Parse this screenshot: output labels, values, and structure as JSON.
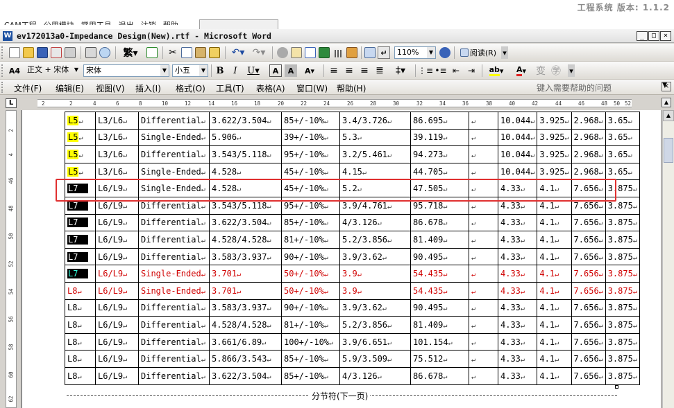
{
  "host": {
    "title": "工程系统 版本: 1.1.2",
    "menu": [
      "CAM工程",
      "公用模块",
      "常用工具",
      "退出",
      "注销",
      "帮助"
    ]
  },
  "window": {
    "title": "ev172013a0-Impedance Design(New).rtf - Microsoft Word",
    "min_label": "_",
    "max_label": "□",
    "close_label": "×"
  },
  "toolbar": {
    "zoom": "110%",
    "read_label": "阅读(R)",
    "style": "正文 + 宋体",
    "font": "宋体",
    "size": "小五",
    "bold": "B",
    "italic": "I",
    "underline": "U"
  },
  "menubar": {
    "items": [
      "文件(F)",
      "编辑(E)",
      "视图(V)",
      "插入(I)",
      "格式(O)",
      "工具(T)",
      "表格(A)",
      "窗口(W)",
      "帮助(H)"
    ],
    "help_placeholder": "键入需要帮助的问题"
  },
  "ruler": {
    "corner": "L",
    "h_ticks": [
      "2",
      "2",
      "4",
      "6",
      "8",
      "10",
      "12",
      "14",
      "16",
      "18",
      "20",
      "22",
      "24",
      "26",
      "28",
      "30",
      "32",
      "34",
      "36",
      "38",
      "40",
      "42",
      "44",
      "46",
      "48",
      "50",
      "52"
    ],
    "v_ticks": [
      "2",
      "4",
      "46",
      "48",
      "50",
      "52",
      "54",
      "56",
      "58",
      "60",
      "62",
      "64"
    ]
  },
  "table": {
    "rows": [
      {
        "layer": "L5",
        "layer_style": "yellow",
        "ref": "L3/L6",
        "type": "Differential",
        "width": "3.622/3.504",
        "imp": "85+/-10%",
        "calc": "3.4/3.726",
        "val": "86.695",
        "e": "",
        "c1": "10.044",
        "c2": "3.925",
        "c3": "2.968",
        "c4": "3.65",
        "red": false
      },
      {
        "layer": "L5",
        "layer_style": "yellow",
        "ref": "L3/L6",
        "type": "Single-Ended",
        "width": "5.906",
        "imp": "39+/-10%",
        "calc": "5.3",
        "val": "39.119",
        "e": "",
        "c1": "10.044",
        "c2": "3.925",
        "c3": "2.968",
        "c4": "3.65",
        "red": false
      },
      {
        "layer": "L5",
        "layer_style": "yellow",
        "ref": "L3/L6",
        "type": "Differential",
        "width": "3.543/5.118",
        "imp": "95+/-10%",
        "calc": "3.2/5.461",
        "val": "94.273",
        "e": "",
        "c1": "10.044",
        "c2": "3.925",
        "c3": "2.968",
        "c4": "3.65",
        "red": false
      },
      {
        "layer": "L5",
        "layer_style": "yellow",
        "ref": "L3/L6",
        "type": "Single-Ended",
        "width": "4.528",
        "imp": "45+/-10%",
        "calc": "4.15",
        "val": "44.705",
        "e": "",
        "c1": "10.044",
        "c2": "3.925",
        "c3": "2.968",
        "c4": "3.65",
        "red": false
      },
      {
        "layer": "L7",
        "layer_style": "black",
        "ref": "L6/L9",
        "type": "Single-Ended",
        "width": "4.528",
        "imp": "45+/-10%",
        "calc": "5.2",
        "val": "47.505",
        "e": "",
        "c1": "4.33",
        "c2": "4.1",
        "c3": "7.656",
        "c4": "3.875",
        "red": false
      },
      {
        "layer": "L7",
        "layer_style": "black",
        "ref": "L6/L9",
        "type": "Differential",
        "width": "3.543/5.118",
        "imp": "95+/-10%",
        "calc": "3.9/4.761",
        "val": "95.718",
        "e": "",
        "c1": "4.33",
        "c2": "4.1",
        "c3": "7.656",
        "c4": "3.875",
        "red": false
      },
      {
        "layer": "L7",
        "layer_style": "black",
        "ref": "L6/L9",
        "type": "Differential",
        "width": "3.622/3.504",
        "imp": "85+/-10%",
        "calc": "4/3.126",
        "val": "86.678",
        "e": "",
        "c1": "4.33",
        "c2": "4.1",
        "c3": "7.656",
        "c4": "3.875",
        "red": false
      },
      {
        "layer": "L7",
        "layer_style": "black",
        "ref": "L6/L9",
        "type": "Differential",
        "width": "4.528/4.528",
        "imp": "81+/-10%",
        "calc": "5.2/3.856",
        "val": "81.409",
        "e": "",
        "c1": "4.33",
        "c2": "4.1",
        "c3": "7.656",
        "c4": "3.875",
        "red": false
      },
      {
        "layer": "L7",
        "layer_style": "black",
        "ref": "L6/L9",
        "type": "Differential",
        "width": "3.583/3.937",
        "imp": "90+/-10%",
        "calc": "3.9/3.62",
        "val": "90.495",
        "e": "",
        "c1": "4.33",
        "c2": "4.1",
        "c3": "7.656",
        "c4": "3.875",
        "red": false
      },
      {
        "layer": "L7",
        "layer_style": "black",
        "ref": "L6/L9",
        "type": "Single-Ended",
        "width": "3.701",
        "imp": "50+/-10%",
        "calc": "3.9",
        "val": "54.435",
        "e": "",
        "c1": "4.33",
        "c2": "4.1",
        "c3": "7.656",
        "c4": "3.875",
        "red": true
      },
      {
        "layer": "L8",
        "layer_style": "none",
        "ref": "L6/L9",
        "type": "Single-Ended",
        "width": "3.701",
        "imp": "50+/-10%",
        "calc": "3.9",
        "val": "54.435",
        "e": "",
        "c1": "4.33",
        "c2": "4.1",
        "c3": "7.656",
        "c4": "3.875",
        "red": true
      },
      {
        "layer": "L8",
        "layer_style": "none",
        "ref": "L6/L9",
        "type": "Differential",
        "width": "3.583/3.937",
        "imp": "90+/-10%",
        "calc": "3.9/3.62",
        "val": "90.495",
        "e": "",
        "c1": "4.33",
        "c2": "4.1",
        "c3": "7.656",
        "c4": "3.875",
        "red": false
      },
      {
        "layer": "L8",
        "layer_style": "none",
        "ref": "L6/L9",
        "type": "Differential",
        "width": "4.528/4.528",
        "imp": "81+/-10%",
        "calc": "5.2/3.856",
        "val": "81.409",
        "e": "",
        "c1": "4.33",
        "c2": "4.1",
        "c3": "7.656",
        "c4": "3.875",
        "red": false
      },
      {
        "layer": "L8",
        "layer_style": "none",
        "ref": "L6/L9",
        "type": "Differential",
        "width": "3.661/6.89",
        "imp": "100+/-10%",
        "calc": "3.9/6.651",
        "val": "101.154",
        "e": "",
        "c1": "4.33",
        "c2": "4.1",
        "c3": "7.656",
        "c4": "3.875",
        "red": false
      },
      {
        "layer": "L8",
        "layer_style": "none",
        "ref": "L6/L9",
        "type": "Differential",
        "width": "5.866/3.543",
        "imp": "85+/-10%",
        "calc": "5.9/3.509",
        "val": "75.512",
        "e": "",
        "c1": "4.33",
        "c2": "4.1",
        "c3": "7.656",
        "c4": "3.875",
        "red": false
      },
      {
        "layer": "L8",
        "layer_style": "none",
        "ref": "L6/L9",
        "type": "Differential",
        "width": "3.622/3.504",
        "imp": "85+/-10%",
        "calc": "4/3.126",
        "val": "86.678",
        "e": "",
        "c1": "4.33",
        "c2": "4.1",
        "c3": "7.656",
        "c4": "3.875",
        "red": false
      }
    ],
    "cell_mark": "↵",
    "highlight_color": "#e03030"
  },
  "section_break": "分节符(下一页)"
}
